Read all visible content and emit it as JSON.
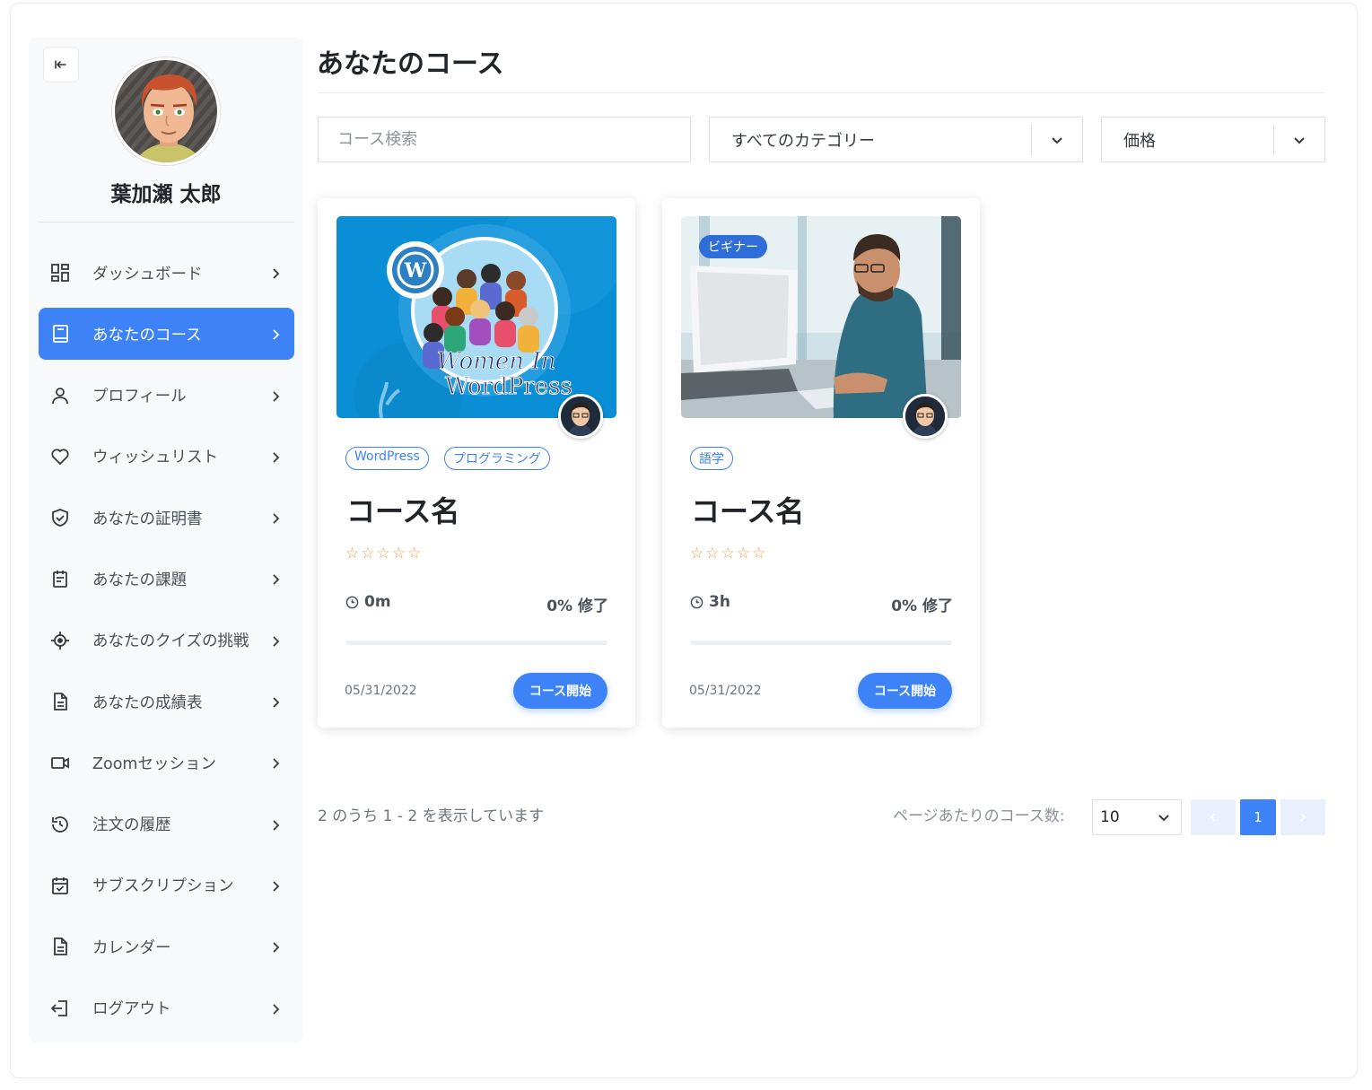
{
  "sidebar": {
    "user_name": "葉加瀬 太郎",
    "items": [
      {
        "label": "ダッシュボード",
        "icon": "dashboard-icon"
      },
      {
        "label": "あなたのコース",
        "icon": "book-icon",
        "active": true
      },
      {
        "label": "プロフィール",
        "icon": "user-icon"
      },
      {
        "label": "ウィッシュリスト",
        "icon": "heart-icon"
      },
      {
        "label": "あなたの証明書",
        "icon": "shield-check-icon"
      },
      {
        "label": "あなたの課題",
        "icon": "clipboard-icon"
      },
      {
        "label": "あなたのクイズの挑戦",
        "icon": "target-icon"
      },
      {
        "label": "あなたの成績表",
        "icon": "document-icon"
      },
      {
        "label": "Zoomセッション",
        "icon": "video-icon"
      },
      {
        "label": "注文の履歴",
        "icon": "history-icon"
      },
      {
        "label": "サブスクリプション",
        "icon": "calendar-check-icon"
      },
      {
        "label": "カレンダー",
        "icon": "document-icon"
      },
      {
        "label": "ログアウト",
        "icon": "logout-icon"
      }
    ]
  },
  "main": {
    "title": "あなたのコース",
    "search_placeholder": "コース検索",
    "category_select": "すべてのカテゴリー",
    "price_select": "価格",
    "courses": [
      {
        "tags": [
          "WordPress",
          "プログラミング"
        ],
        "name": "コース名",
        "duration": "0m",
        "progress_label": "0% 修了",
        "progress": 0,
        "date": "05/31/2022",
        "button": "コース開始",
        "thumb_text_1": "Women In",
        "thumb_text_2": "WordPress"
      },
      {
        "level": "ビギナー",
        "tags": [
          "語学"
        ],
        "name": "コース名",
        "duration": "3h",
        "progress_label": "0% 修了",
        "progress": 0,
        "date": "05/31/2022",
        "button": "コース開始"
      }
    ],
    "pagination": {
      "showing": "2 のうち 1 - 2 を表示しています",
      "per_page_label": "ページあたりのコース数:",
      "per_page_value": "10",
      "current_page": "1"
    }
  },
  "colors": {
    "accent": "#3e82f7",
    "star": "#f0a14a"
  }
}
